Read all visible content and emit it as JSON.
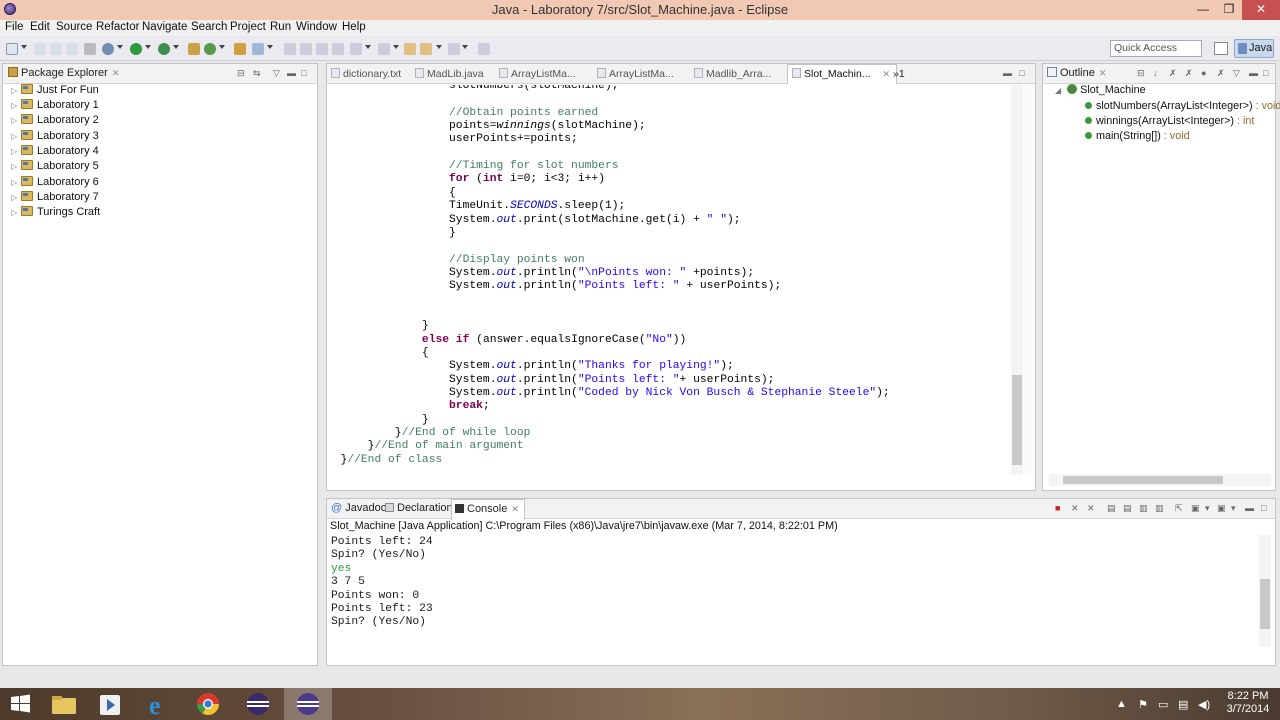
{
  "window": {
    "title": "Java - Laboratory 7/src/Slot_Machine.java - Eclipse",
    "min_glyph": "—",
    "max_glyph": "❐",
    "close_glyph": "✕"
  },
  "menu": [
    "File",
    "Edit",
    "Source",
    "Refactor",
    "Navigate",
    "Search",
    "Project",
    "Run",
    "Window",
    "Help"
  ],
  "toolbar": {
    "quick_access_placeholder": "Quick Access",
    "perspective": "Java"
  },
  "package_explorer": {
    "title": "Package Explorer",
    "items": [
      "Just For Fun",
      "Laboratory 1",
      "Laboratory 2",
      "Laboratory 3",
      "Laboratory 4",
      "Laboratory 5",
      "Laboratory 6",
      "Laboratory 7",
      "Turings Craft"
    ]
  },
  "editor": {
    "tabs": [
      "dictionary.txt",
      "MadLib.java",
      "ArrayListMa...",
      "ArrayListMa...",
      "Madlib_Arra...",
      "Slot_Machin..."
    ],
    "overflow": "»1",
    "code": [
      [
        {
          "t": "                  slotNumbers(slotMachine);"
        }
      ],
      [
        {
          "t": ""
        }
      ],
      [
        {
          "t": "                  "
        },
        {
          "t": "//Obtain points earned",
          "c": "cm"
        }
      ],
      [
        {
          "t": "                  points="
        },
        {
          "t": "winnings",
          "c": "it"
        },
        {
          "t": "(slotMachine);"
        }
      ],
      [
        {
          "t": "                  userPoints+=points;"
        }
      ],
      [
        {
          "t": ""
        }
      ],
      [
        {
          "t": "                  "
        },
        {
          "t": "//Timing for slot numbers",
          "c": "cm"
        }
      ],
      [
        {
          "t": "                  "
        },
        {
          "t": "for",
          "c": "kw"
        },
        {
          "t": " ("
        },
        {
          "t": "int",
          "c": "kw"
        },
        {
          "t": " i=0; i<3; i++)"
        }
      ],
      [
        {
          "t": "                  {"
        }
      ],
      [
        {
          "t": "                  TimeUnit."
        },
        {
          "t": "SECONDS",
          "c": "fld"
        },
        {
          "t": ".sleep(1);"
        }
      ],
      [
        {
          "t": "                  System."
        },
        {
          "t": "out",
          "c": "fld"
        },
        {
          "t": ".print(slotMachine.get(i) + "
        },
        {
          "t": "\" \"",
          "c": "str"
        },
        {
          "t": ");"
        }
      ],
      [
        {
          "t": "                  }"
        }
      ],
      [
        {
          "t": ""
        }
      ],
      [
        {
          "t": "                  "
        },
        {
          "t": "//Display points won",
          "c": "cm"
        }
      ],
      [
        {
          "t": "                  System."
        },
        {
          "t": "out",
          "c": "fld"
        },
        {
          "t": ".println("
        },
        {
          "t": "\"\\nPoints won: \"",
          "c": "str"
        },
        {
          "t": " +points);"
        }
      ],
      [
        {
          "t": "                  System."
        },
        {
          "t": "out",
          "c": "fld"
        },
        {
          "t": ".println("
        },
        {
          "t": "\"Points left: \"",
          "c": "str"
        },
        {
          "t": " + userPoints);"
        }
      ],
      [
        {
          "t": ""
        }
      ],
      [
        {
          "t": ""
        }
      ],
      [
        {
          "t": "              }"
        }
      ],
      [
        {
          "t": "              "
        },
        {
          "t": "else",
          "c": "kw"
        },
        {
          "t": " "
        },
        {
          "t": "if",
          "c": "kw"
        },
        {
          "t": " (answer.equalsIgnoreCase("
        },
        {
          "t": "\"No\"",
          "c": "str"
        },
        {
          "t": "))"
        }
      ],
      [
        {
          "t": "              {"
        }
      ],
      [
        {
          "t": "                  System."
        },
        {
          "t": "out",
          "c": "fld"
        },
        {
          "t": ".println("
        },
        {
          "t": "\"Thanks for playing!\"",
          "c": "str"
        },
        {
          "t": ");"
        }
      ],
      [
        {
          "t": "                  System."
        },
        {
          "t": "out",
          "c": "fld"
        },
        {
          "t": ".println("
        },
        {
          "t": "\"Points left: \"",
          "c": "str"
        },
        {
          "t": "+ userPoints);"
        }
      ],
      [
        {
          "t": "                  System."
        },
        {
          "t": "out",
          "c": "fld"
        },
        {
          "t": ".println("
        },
        {
          "t": "\"Coded by Nick Von Busch & Stephanie Steele\"",
          "c": "str"
        },
        {
          "t": ");"
        }
      ],
      [
        {
          "t": "                  "
        },
        {
          "t": "break",
          "c": "kw"
        },
        {
          "t": ";"
        }
      ],
      [
        {
          "t": "              }"
        }
      ],
      [
        {
          "t": "          }"
        },
        {
          "t": "//End of while loop",
          "c": "cm"
        }
      ],
      [
        {
          "t": "      }"
        },
        {
          "t": "//End of main argument",
          "c": "cm"
        }
      ],
      [
        {
          "t": "  }"
        },
        {
          "t": "//End of class",
          "c": "cm"
        }
      ]
    ]
  },
  "outline": {
    "title": "Outline",
    "class_name": "Slot_Machine",
    "members": [
      {
        "name": "slotNumbers(ArrayList<Integer>)",
        "type": " : void"
      },
      {
        "name": "winnings(ArrayList<Integer>)",
        "type": " : int"
      },
      {
        "name": "main(String[])",
        "type": " : void"
      }
    ]
  },
  "bottom_tabs": [
    "Javadoc",
    "Declaration",
    "Console"
  ],
  "console": {
    "launch": "Slot_Machine [Java Application] C:\\Program Files (x86)\\Java\\jre7\\bin\\javaw.exe (Mar 7, 2014, 8:22:01 PM)",
    "lines": [
      {
        "text": "Points left: 24",
        "input": false
      },
      {
        "text": "Spin? (Yes/No)",
        "input": false
      },
      {
        "text": "yes",
        "input": true
      },
      {
        "text": "3 7 5",
        "input": false
      },
      {
        "text": "Points won: 0",
        "input": false
      },
      {
        "text": "Points left: 23",
        "input": false
      },
      {
        "text": "Spin? (Yes/No)",
        "input": false
      }
    ]
  },
  "taskbar": {
    "time": "8:22 PM",
    "date": "3/7/2014"
  },
  "colors": {
    "titlebar": "#f0c8b4",
    "comment": "#3f7f5f",
    "keyword": "#7f0055",
    "string": "#2a00ff",
    "console_input": "#2aa245"
  }
}
